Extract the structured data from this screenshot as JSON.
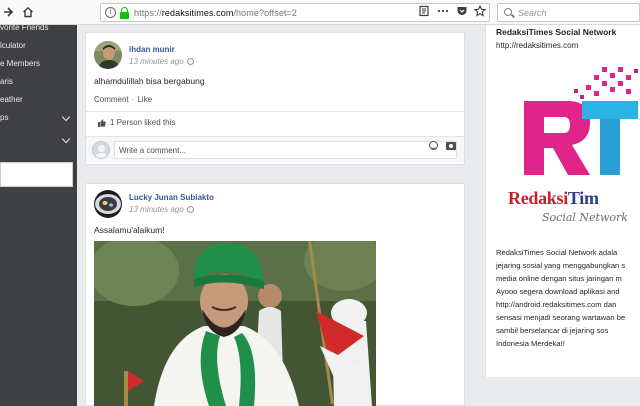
{
  "browser": {
    "url_scheme": "https://",
    "url_host": "redaksitimes.com",
    "url_path": "/home?offset=2",
    "search_placeholder": "Search"
  },
  "sidebar": {
    "items": [
      {
        "label": "vorite Friends",
        "has_chevron": false
      },
      {
        "label": "lculator",
        "has_chevron": false
      },
      {
        "label": "e Members",
        "has_chevron": false
      },
      {
        "label": "aris",
        "has_chevron": false
      },
      {
        "label": "eather",
        "has_chevron": false
      },
      {
        "label": "ps",
        "has_chevron": true
      },
      {
        "label": "",
        "has_chevron": true
      }
    ]
  },
  "posts": [
    {
      "author": "ihdan munir",
      "time": "13 minutes ago",
      "text": "alhamdulillah bisa bergabung",
      "comment_label": "Comment",
      "like_label": "Like",
      "likes_text": "1 Person liked this",
      "comment_placeholder": "Write a comment..."
    },
    {
      "author": "Lucky Junan Subiakto",
      "time": "13 minutes ago",
      "text": "Assalamu'alaikum!"
    }
  ],
  "right_panel": {
    "title": "RedaksiTimes Social Network",
    "link": "http://redaksitimes.com",
    "logo_letters": "RT",
    "brand_red": "Redaksi",
    "brand_blue": "Tim",
    "tagline": "Social Network",
    "description_lines": [
      "RedaksiTimes Social Network adala",
      "jejaring sosial yang menggabungkan s",
      "media online dengan situs jaringan m",
      "Ayooo segera download aplikasi and",
      "http://android.redaksitimes.com dan",
      "sensasi menjadi seorang wartawan be",
      "sambil berselancar di jejaring sos",
      "Indonesia Merdeka!!"
    ]
  },
  "colors": {
    "sidebar_bg": "#3f4043",
    "link_blue": "#365899",
    "lock_green": "#12bc00",
    "logo_magenta": "#e0248a",
    "logo_cyan": "#2bb3e6",
    "brand_red": "#c8202e",
    "brand_blue": "#2e3a8c"
  }
}
